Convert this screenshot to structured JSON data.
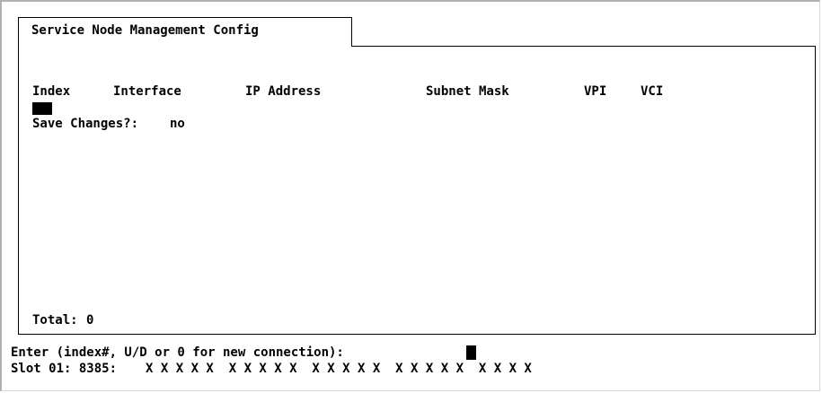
{
  "tab": {
    "title": "Service Node Management Config"
  },
  "table": {
    "columns": [
      "Index",
      "Interface",
      "IP Address",
      "Subnet Mask",
      "VPI",
      "VCI"
    ],
    "rows": []
  },
  "form": {
    "save_changes_label": "Save Changes?:",
    "save_changes_value": "no"
  },
  "footer": {
    "total_label": "Total:",
    "total_value": "0"
  },
  "prompt": {
    "text": "Enter (index#, U/D or 0 for new connection):"
  },
  "status": {
    "slot_label": "Slot 01: 8385:",
    "slot_ports": "X X X X X  X X X X X  X X X X X  X X X X X  X X X X"
  }
}
